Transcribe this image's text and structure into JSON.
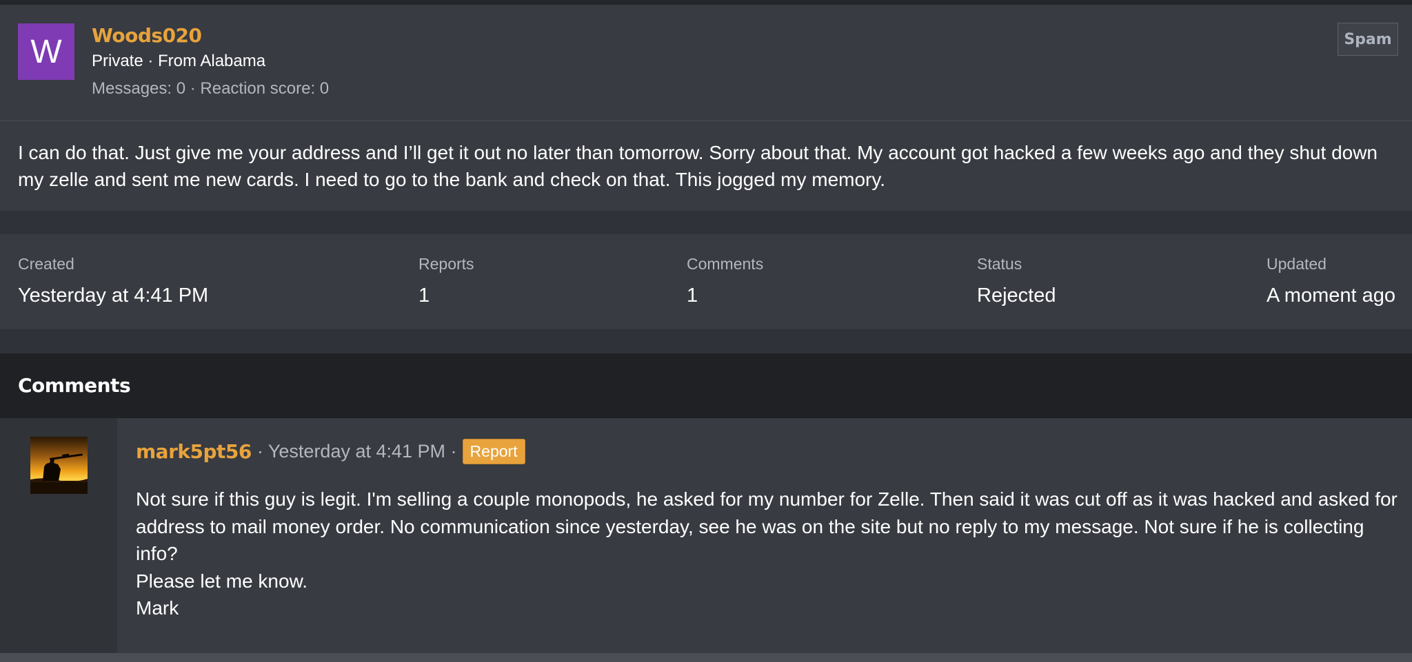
{
  "user": {
    "avatar_letter": "W",
    "avatar_color": "#7e3bb3",
    "name": "Woods020",
    "subtitle": "Private · From Alabama",
    "meta": "Messages: 0 · Reaction score: 0",
    "spam_label": "Spam"
  },
  "message": {
    "text": "I can do that. Just give me your address and I’ll get it out no later than tomorrow. Sorry about that. My account got hacked a few weeks ago and they shut down my zelle and sent me new cards. I need to go to the bank and check on that. This jogged my memory."
  },
  "stats": [
    {
      "label": "Created",
      "value": "Yesterday at 4:41 PM"
    },
    {
      "label": "Reports",
      "value": "1"
    },
    {
      "label": "Comments",
      "value": "1"
    },
    {
      "label": "Status",
      "value": "Rejected"
    },
    {
      "label": "Updated",
      "value": "A moment ago"
    }
  ],
  "comments": {
    "heading": "Comments",
    "items": [
      {
        "author": "mark5pt56",
        "meta": "· Yesterday at 4:41 PM ·",
        "report_label": "Report",
        "body": [
          "Not sure if this guy is legit. I'm selling a couple monopods, he asked for my number for Zelle. Then said it was cut off as it was hacked and asked for address to mail money order. No communication since yesterday, see he was on the site but no reply to my message. Not sure if he is collecting info?",
          "Please let me know.",
          "Mark"
        ]
      }
    ]
  },
  "colors": {
    "accent": "#e8a33d",
    "panel": "#383b41",
    "background": "#2b2e34",
    "muted_text": "#b4b7bc"
  }
}
